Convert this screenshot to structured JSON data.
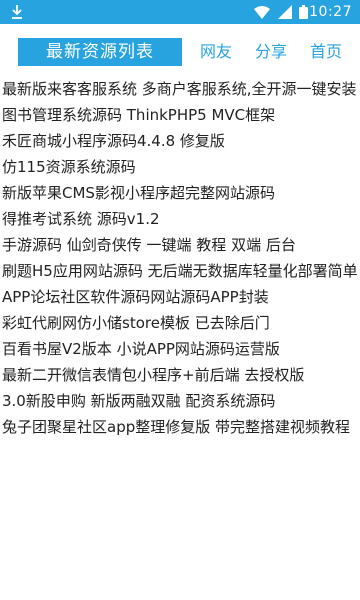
{
  "status_bar": {
    "time": "10:27",
    "icons": [
      "download-icon",
      "wifi-icon",
      "cellular-signal-icon",
      "battery-icon"
    ],
    "background": "#27a3e0"
  },
  "header": {
    "title": "最新资源列表",
    "nav": [
      "网友",
      "分享",
      "首页"
    ],
    "accent": "#27a3e0"
  },
  "items": [
    "最新版来客客服系统 多商户客服系统,全开源一键安装",
    "图书管理系统源码 ThinkPHP5 MVC框架",
    "禾匠商城小程序源码4.4.8 修复版",
    "仿115资源系统源码",
    "新版苹果CMS影视小程序超完整网站源码",
    "得推考试系统 源码v1.2",
    "手游源码 仙剑奇侠传 一键端 教程 双端 后台",
    "刷题H5应用网站源码 无后端无数据库轻量化部署简单",
    "APP论坛社区软件源码网站源码APP封装",
    "彩虹代刷网仿小储store模板 已去除后门",
    "百看书屋V2版本 小说APP网站源码运营版",
    "最新二开微信表情包小程序+前后端 去授权版",
    "3.0新股申购 新版两融双融 配资系统源码",
    "兔子团聚星社区app整理修复版 带完整搭建视频教程"
  ]
}
